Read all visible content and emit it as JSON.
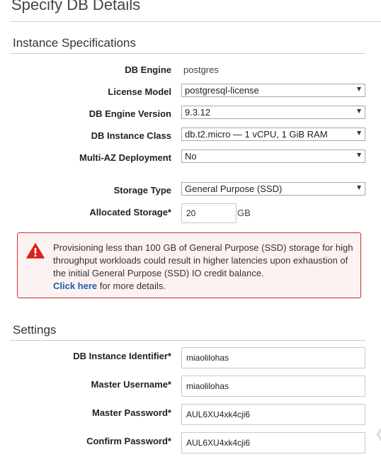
{
  "page": {
    "title": "Specify DB Details"
  },
  "instance_specs": {
    "header": "Instance Specifications",
    "db_engine": {
      "label": "DB Engine",
      "value": "postgres"
    },
    "license_model": {
      "label": "License Model",
      "value": "postgresql-license"
    },
    "engine_version": {
      "label": "DB Engine Version",
      "value": "9.3.12"
    },
    "instance_class": {
      "label": "DB Instance Class",
      "value": "db.t2.micro — 1 vCPU, 1 GiB RAM"
    },
    "multi_az": {
      "label": "Multi-AZ Deployment",
      "value": "No"
    },
    "storage_type": {
      "label": "Storage Type",
      "value": "General Purpose (SSD)"
    },
    "allocated_storage": {
      "label": "Allocated Storage*",
      "value": "20",
      "unit": "GB"
    }
  },
  "alert": {
    "message": "Provisioning less than 100 GB of General Purpose (SSD) storage for high throughput workloads could result in higher latencies upon exhaustion of the initial General Purpose (SSD) IO credit balance.",
    "link_text": "Click here",
    "suffix": " for more details.",
    "color": "#c9302c",
    "icon": "warning-triangle-icon"
  },
  "settings": {
    "header": "Settings",
    "instance_identifier": {
      "label": "DB Instance Identifier*",
      "value": "miaolilohas"
    },
    "master_username": {
      "label": "Master Username*",
      "value": "miaolilohas"
    },
    "master_password": {
      "label": "Master Password*",
      "value": "AUL6XU4xk4cji6"
    },
    "confirm_password": {
      "label": "Confirm Password*",
      "value": "AUL6XU4xk4cji6"
    }
  }
}
